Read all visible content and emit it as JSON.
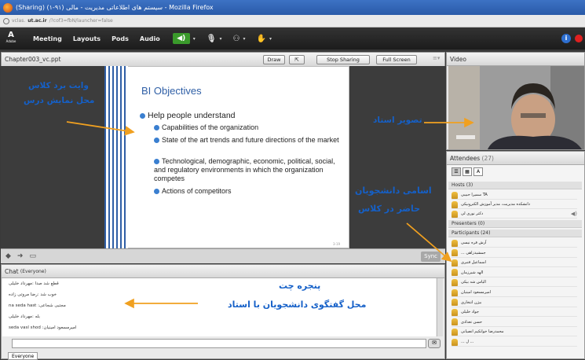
{
  "window_title": "(Sharing) (سیستم های اطلاعاتی مدیریت - مالی (۹۱-۱ - Mozilla Firefox",
  "url": {
    "prefix": "vclas.",
    "domain": "ut.ac.ir",
    "rest": "/?cof3=fbN/launcher=false"
  },
  "menu": {
    "logo": "Adobe",
    "items": [
      "Meeting",
      "Layouts",
      "Pods",
      "Audio"
    ]
  },
  "share_pod": {
    "title": "Chapter003_vc.ppt",
    "buttons": {
      "draw": "Draw",
      "stop": "Stop Sharing",
      "full": "Full Screen"
    },
    "sync": "Sync"
  },
  "slide": {
    "title": "BI Objectives",
    "main_bullet": "Help people understand",
    "bullets": [
      "Capabilities of the organization",
      "State of the art trends and future directions of the market",
      "Technological, demographic, economic, political, social, and regulatory environments in which the organization competes",
      "Actions of competitors"
    ],
    "page": "3-19"
  },
  "annotations": {
    "whiteboard_1": "وایت برد کلاس",
    "whiteboard_2": "محل نمایش درس",
    "teacher": "تصویر استاد",
    "students_1": "اسامی دانشجویان",
    "students_2": "حاضر در کلاس",
    "chat_1": "پنجره چت",
    "chat_2": "محل گفتگوی دانشجویان با استاد"
  },
  "chat": {
    "title": "Chat",
    "scope": "(Everyone)",
    "messages": [
      "قطع شد صدا :مهرداد خلیلی",
      "خوب شد :رضا مروتی زاده",
      "na seda hast :مجتبی شجاعی",
      "بله :مهرداد خلیلی",
      "seda vasl shod :امیرمسعود امینیان"
    ],
    "tab": "Everyone"
  },
  "video": {
    "title": "Video"
  },
  "attendees": {
    "title": "Attendees",
    "count": "(27)",
    "hosts_label": "Hosts (3)",
    "hosts": [
      "سمیرا حبیبی TA",
      "دانشکده مدیریت، مدیر آموزش الکترونیکی",
      "دکتر نوری لی"
    ],
    "presenters_label": "Presenters (0)",
    "participants_label": "Participants (24)",
    "participants": [
      "آرش قره نیسی",
      "... جمشیدزاهی",
      "اسماعیل قنبری",
      "الهه شیرزمان",
      "الیاس شه بیکی",
      "امیرمسعود امینیان",
      "بیژن انتخاری",
      "جواد خلیلی",
      "حسن تعدادی",
      "محمدرضا خوانکیم انصیانی",
      "... ل ..."
    ]
  },
  "colors": {
    "accent": "#2f5fa6",
    "annotation": "#1560c8",
    "arrow": "#f0a020",
    "audio": "#3a9a2b"
  }
}
